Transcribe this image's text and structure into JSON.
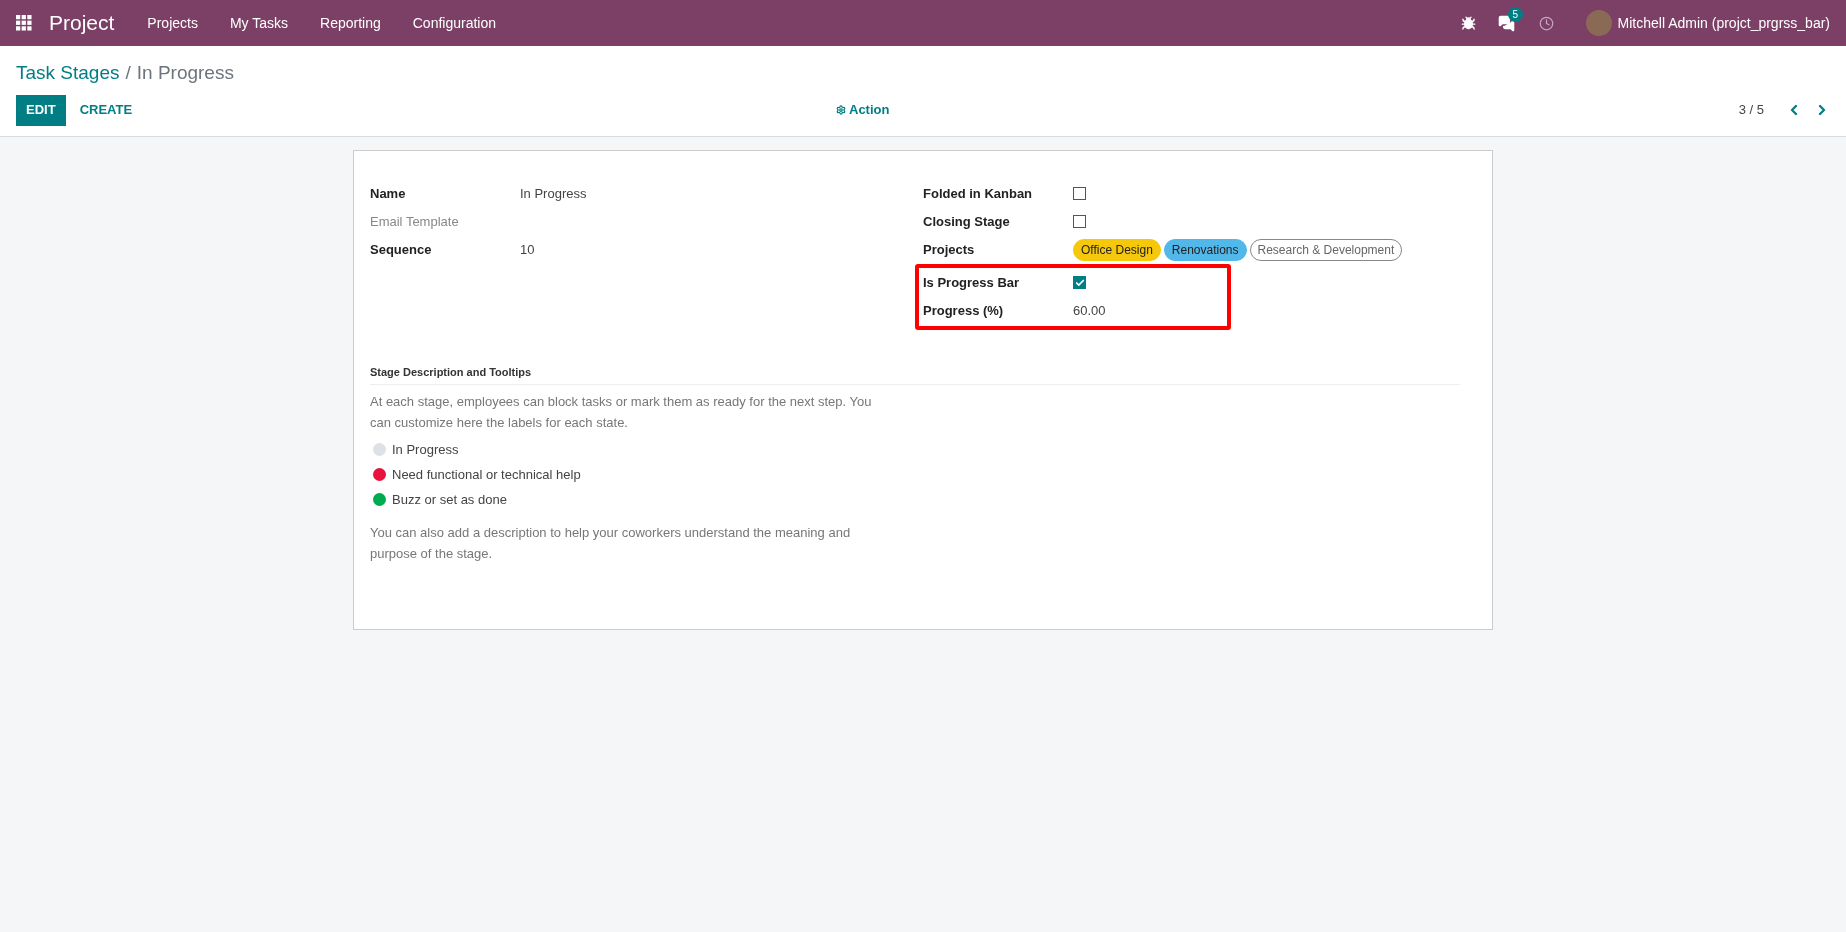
{
  "navbar": {
    "app_title": "Project",
    "menu": [
      "Projects",
      "My Tasks",
      "Reporting",
      "Configuration"
    ],
    "message_count": "5",
    "user_name": "Mitchell Admin (projct_prgrss_bar)"
  },
  "breadcrumb": {
    "parent": "Task Stages",
    "separator": "/",
    "current": "In Progress"
  },
  "control_panel": {
    "buttons": [
      {
        "label": "EDIT",
        "kind": "primary"
      },
      {
        "label": "CREATE",
        "kind": "link"
      }
    ],
    "action": "Action",
    "pager": "3 / 5"
  },
  "left_fields": [
    {
      "label": "Name",
      "value": "In Progress",
      "muted": false
    },
    {
      "label": "Email Template",
      "muted": true
    },
    {
      "label": "Sequence",
      "value": "10",
      "muted": false
    }
  ],
  "right_fields": [
    {
      "label": "Folded in Kanban",
      "kind": "checkbox",
      "checked": false,
      "highlighted": false
    },
    {
      "label": "Closing Stage",
      "kind": "checkbox",
      "checked": false,
      "highlighted": false
    },
    {
      "label": "Projects",
      "kind": "tags",
      "highlighted": false,
      "tags": [
        {
          "label": "Office Design",
          "kind": "filled",
          "color": "#f5c80c"
        },
        {
          "label": "Renovations",
          "kind": "filled",
          "color": "#52b8ea"
        },
        {
          "label": "Research & Development",
          "kind": "outline"
        }
      ]
    },
    {
      "label": "Is Progress Bar",
      "kind": "checkbox",
      "checked": true,
      "highlighted": true
    },
    {
      "label": "Progress (%)",
      "kind": "text",
      "value": "60.00",
      "highlighted": true
    }
  ],
  "section": {
    "title": "Stage Description and Tooltips",
    "intro": "At each stage, employees can block tasks or mark them as ready for the next step. You can customize here the labels for each state.",
    "states": [
      {
        "label": "In Progress",
        "color": "#dee2e6"
      },
      {
        "label": "Need functional or technical help",
        "color": "#e8123c"
      },
      {
        "label": "Buzz or set as done",
        "color": "#00aa4f"
      }
    ],
    "footer": "You can also add a description to help your coworkers understand the meaning and purpose of the stage."
  }
}
